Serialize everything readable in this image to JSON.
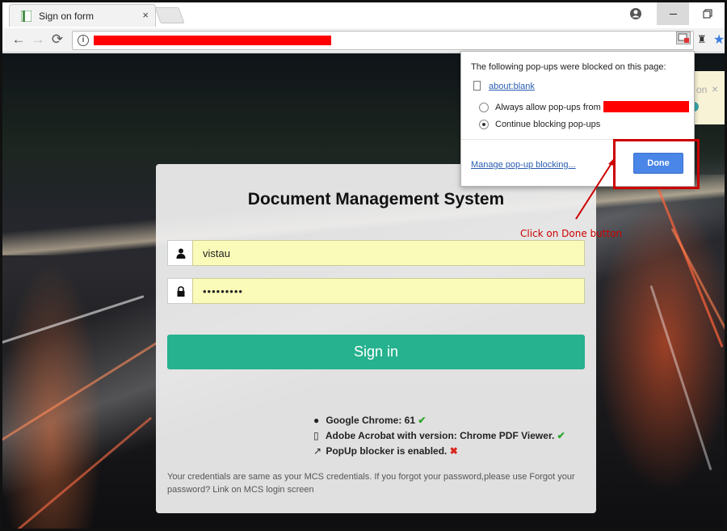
{
  "browser": {
    "tab_title": "Sign on form",
    "tab_close": "×",
    "nav": {
      "back": "←",
      "forward": "→",
      "reload": "⟳"
    },
    "omnibox_info": "i"
  },
  "popup_bubble": {
    "header": "The following pop-ups were blocked on this page:",
    "blocked_link": "about:blank",
    "option_allow": "Always allow pop-ups from",
    "option_continue": "Continue blocking pop-ups",
    "selected_option": "Continue blocking pop-ups",
    "manage_link": "Manage pop-up blocking...",
    "done_label": "Done"
  },
  "annotation": {
    "text": "Click on Done button",
    "color": "#cc0000"
  },
  "partial_notification": {
    "text": "on",
    "close": "×"
  },
  "login": {
    "title": "Document Management System",
    "username_value": "vistau",
    "password_value": "•••••••••",
    "signin_label": "Sign in",
    "accent": "#26b28e"
  },
  "status": {
    "chrome": "Google Chrome: 61",
    "acrobat": "Adobe Acrobat with version: Chrome PDF Viewer.",
    "popup": "PopUp blocker is enabled.",
    "check_mark": "✔",
    "cross_mark": "✖"
  },
  "note": "Your credentials are same as your MCS credentials. If you forgot your password,please use Forgot your password? Link on MCS login screen"
}
